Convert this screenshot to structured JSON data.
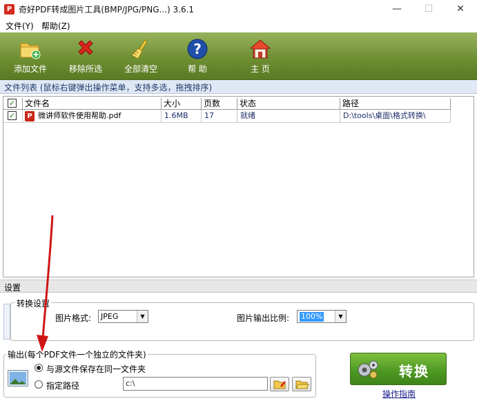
{
  "window": {
    "title": "奇好PDF转成图片工具(BMP/JPG/PNG...) 3.6.1",
    "minimize": "—",
    "maximize": "☐",
    "close": "✕"
  },
  "menu": {
    "file": "文件(Y)",
    "help": "帮助(Z)"
  },
  "toolbar": {
    "add_file": "添加文件",
    "remove_selected": "移除所选",
    "clear_all": "全部清空",
    "help": "帮 助",
    "home": "主 页"
  },
  "file_list": {
    "header": "文件列表  (鼠标右键弹出操作菜单，支持多选，拖拽排序)",
    "columns": [
      "文件名",
      "大小",
      "页数",
      "状态",
      "路径"
    ],
    "rows": [
      {
        "checked": true,
        "name": "微讲师软件使用帮助.pdf",
        "size": "1.6MB",
        "pages": "17",
        "status": "就绪",
        "path": "D:\\tools\\桌面\\格式转换\\"
      }
    ]
  },
  "settings": {
    "header": "设置",
    "convert_group": "转换设置",
    "format_label": "图片格式:",
    "format_value": "JPEG",
    "scale_label": "图片输出比例:",
    "scale_value": "100%"
  },
  "output": {
    "group": "输出(每个PDF文件一个独立的文件夹)",
    "same_folder": "与源文件保存在同一文件夹",
    "custom_path": "指定路径",
    "path_value": "c:\\",
    "selected": "same_folder"
  },
  "actions": {
    "convert": "转换",
    "guide": "操作指南"
  }
}
